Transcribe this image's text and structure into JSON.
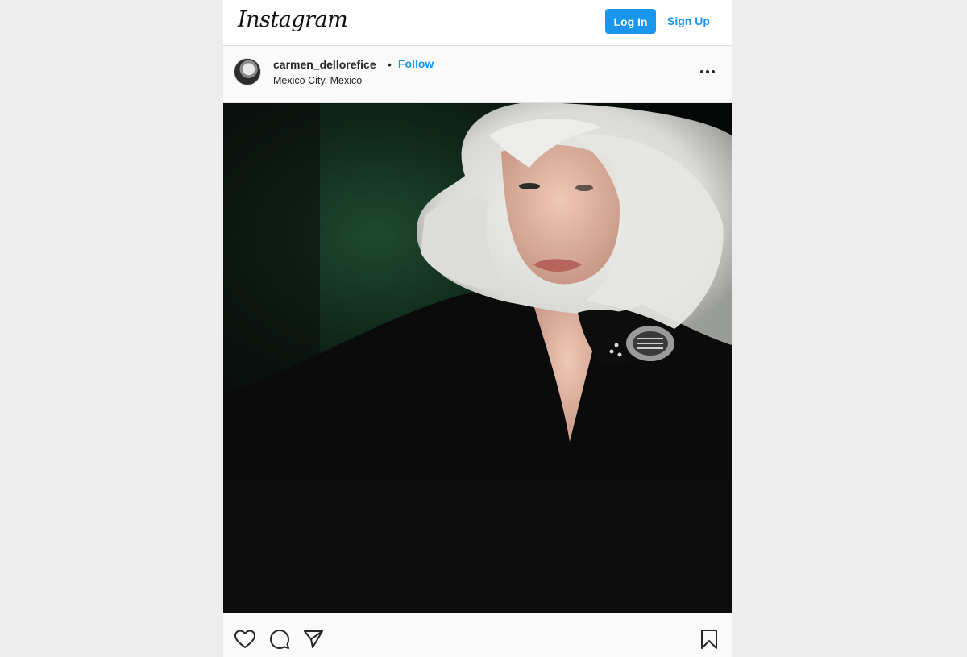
{
  "header": {
    "logo_text": "Instagram",
    "login_label": "Log In",
    "signup_label": "Sign Up"
  },
  "post": {
    "username": "carmen_dellorefice",
    "separator": "•",
    "follow_label": "Follow",
    "location": "Mexico City, Mexico",
    "more_icon": "more-horizontal-icon"
  },
  "actions": {
    "like_icon": "heart-icon",
    "comment_icon": "comment-icon",
    "share_icon": "send-icon",
    "save_icon": "bookmark-icon"
  },
  "colors": {
    "accent": "#1a95ec",
    "text": "#262626",
    "border": "#dbdbdb",
    "page_bg": "#ededed"
  }
}
